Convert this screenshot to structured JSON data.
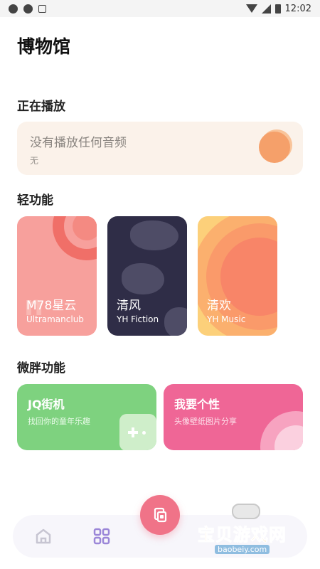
{
  "status_bar": {
    "time": "12:02"
  },
  "page": {
    "title": "博物馆"
  },
  "now_playing": {
    "section_title": "正在播放",
    "title": "没有播放任何音频",
    "subtitle": "无"
  },
  "light_features": {
    "section_title": "轻功能",
    "cards": [
      {
        "title": "M78星云",
        "subtitle": "Ultramanclub"
      },
      {
        "title": "清风",
        "subtitle": "YH Fiction"
      },
      {
        "title": "清欢",
        "subtitle": "YH Music"
      }
    ]
  },
  "weipang_features": {
    "section_title": "微胖功能",
    "cards": [
      {
        "title": "JQ街机",
        "subtitle": "找回你的童年乐趣"
      },
      {
        "title": "我要个性",
        "subtitle": "头像壁纸图片分享"
      }
    ]
  },
  "bottom_nav": {
    "items": [
      "home-icon",
      "apps-icon"
    ],
    "fab_icon": "document-icon"
  },
  "watermark": {
    "title": "宝贝游戏网",
    "url": "baobeiy.com"
  },
  "colors": {
    "now_playing_bg": "#fbf2ea",
    "ultraman_card": "#f7a09c",
    "fiction_card": "#2f2d47",
    "music_card": "#fcd07a",
    "jq_card": "#7ed27f",
    "personal_card": "#ef6696",
    "fab": "#f07388",
    "nav_accent": "#9b86d8"
  }
}
